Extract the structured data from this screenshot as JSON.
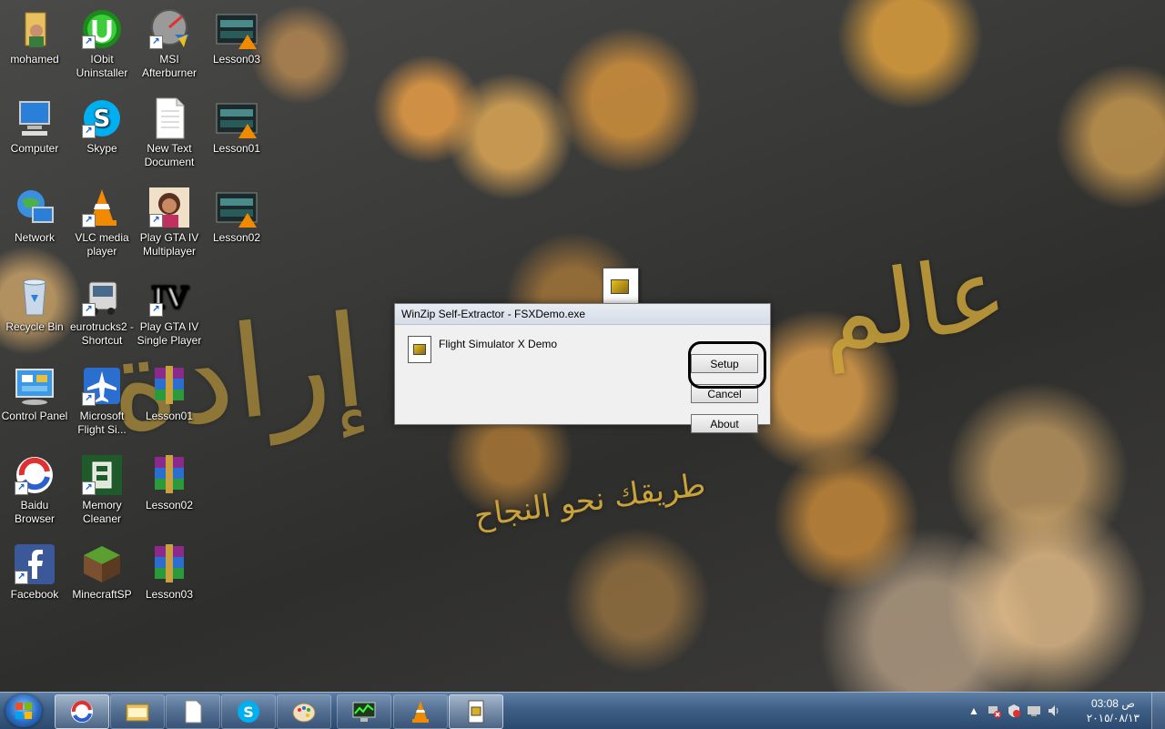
{
  "desktop": {
    "icons": [
      {
        "label": "mohamed"
      },
      {
        "label": "IObit Uninstaller"
      },
      {
        "label": "MSI Afterburner"
      },
      {
        "label": "Lesson03"
      },
      {
        "label": "Computer"
      },
      {
        "label": "Skype"
      },
      {
        "label": "New Text Document"
      },
      {
        "label": "Lesson01"
      },
      {
        "label": "Network"
      },
      {
        "label": "VLC media player"
      },
      {
        "label": "Play GTA IV Multiplayer"
      },
      {
        "label": "Lesson02"
      },
      {
        "label": "Recycle Bin"
      },
      {
        "label": "eurotrucks2 - Shortcut"
      },
      {
        "label": "Play GTA IV Single Player"
      },
      {
        "label": "Control Panel"
      },
      {
        "label": "Microsoft Flight Si..."
      },
      {
        "label": "Lesson01"
      },
      {
        "label": "Baidu Browser"
      },
      {
        "label": "Memory Cleaner"
      },
      {
        "label": "Lesson02"
      },
      {
        "label": "Facebook"
      },
      {
        "label": "MinecraftSP"
      },
      {
        "label": "Lesson03"
      }
    ]
  },
  "dialog": {
    "title": "WinZip Self-Extractor - FSXDemo.exe",
    "message": "Flight Simulator X Demo",
    "setup_label": "Setup",
    "cancel_label": "Cancel",
    "about_label": "About"
  },
  "taskbar": {
    "clock_time": "03:08 ص",
    "clock_date": "٢٠١٥/٠٨/١٣"
  }
}
